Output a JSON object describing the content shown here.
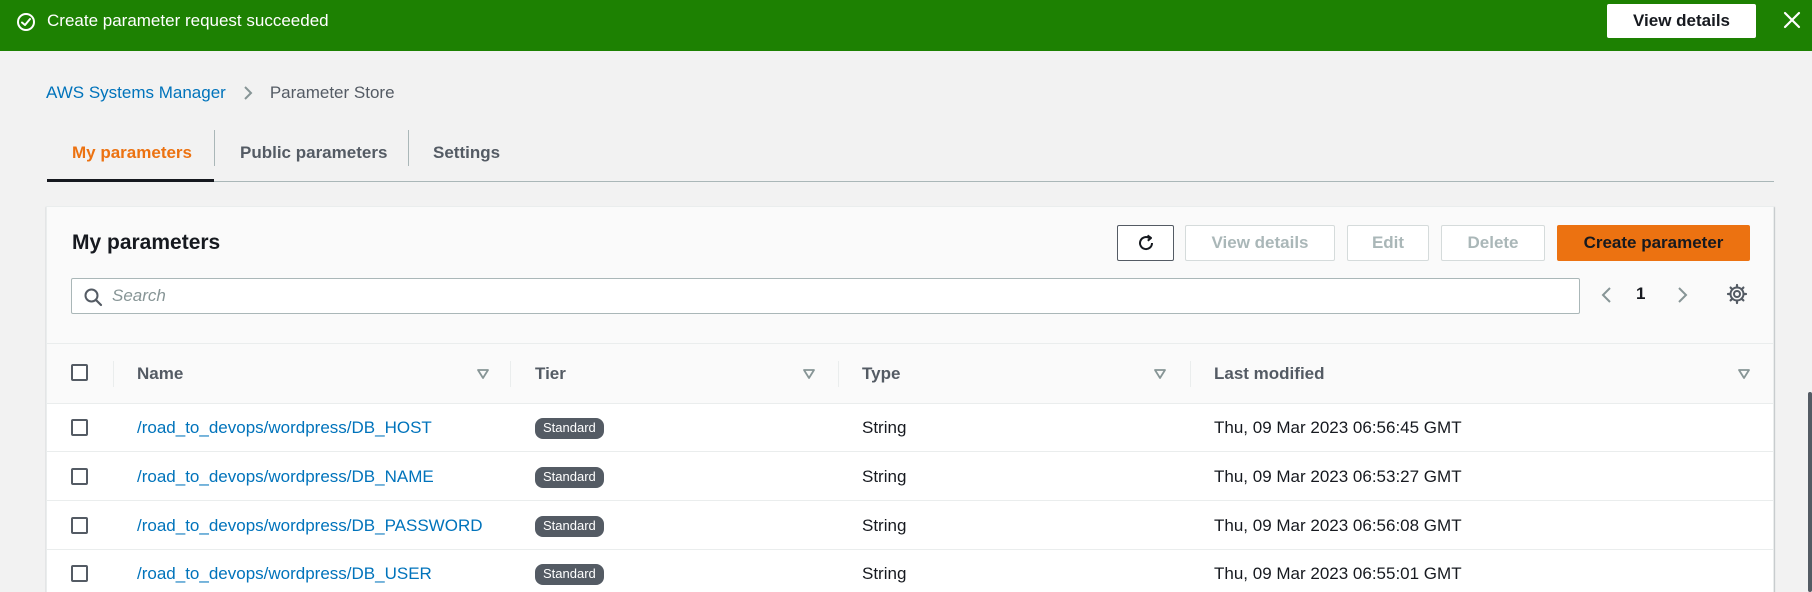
{
  "flash": {
    "message": "Create parameter request succeeded",
    "button_label": "View details",
    "icon": "check-circle-icon",
    "close_icon": "close-icon",
    "color": "#1d8102"
  },
  "breadcrumb": {
    "items": [
      "AWS Systems Manager",
      "Parameter Store"
    ]
  },
  "tabs": [
    {
      "label": "My parameters",
      "active": true
    },
    {
      "label": "Public parameters",
      "active": false
    },
    {
      "label": "Settings",
      "active": false
    }
  ],
  "panel": {
    "title": "My parameters",
    "buttons": {
      "refresh_icon": "refresh-icon",
      "view_details": "View details",
      "edit": "Edit",
      "delete": "Delete",
      "create": "Create parameter"
    },
    "search": {
      "placeholder": "Search",
      "value": ""
    },
    "pagination": {
      "current_page": "1"
    }
  },
  "table": {
    "columns": [
      "Name",
      "Tier",
      "Type",
      "Last modified"
    ],
    "rows": [
      {
        "name": "/road_to_devops/wordpress/DB_HOST",
        "tier": "Standard",
        "type": "String",
        "last_modified": "Thu, 09 Mar 2023 06:56:45 GMT"
      },
      {
        "name": "/road_to_devops/wordpress/DB_NAME",
        "tier": "Standard",
        "type": "String",
        "last_modified": "Thu, 09 Mar 2023 06:53:27 GMT"
      },
      {
        "name": "/road_to_devops/wordpress/DB_PASSWORD",
        "tier": "Standard",
        "type": "String",
        "last_modified": "Thu, 09 Mar 2023 06:56:08 GMT"
      },
      {
        "name": "/road_to_devops/wordpress/DB_USER",
        "tier": "Standard",
        "type": "String",
        "last_modified": "Thu, 09 Mar 2023 06:55:01 GMT"
      }
    ]
  },
  "colors": {
    "accent": "#ec7211",
    "link": "#0073bb",
    "success": "#1d8102"
  }
}
